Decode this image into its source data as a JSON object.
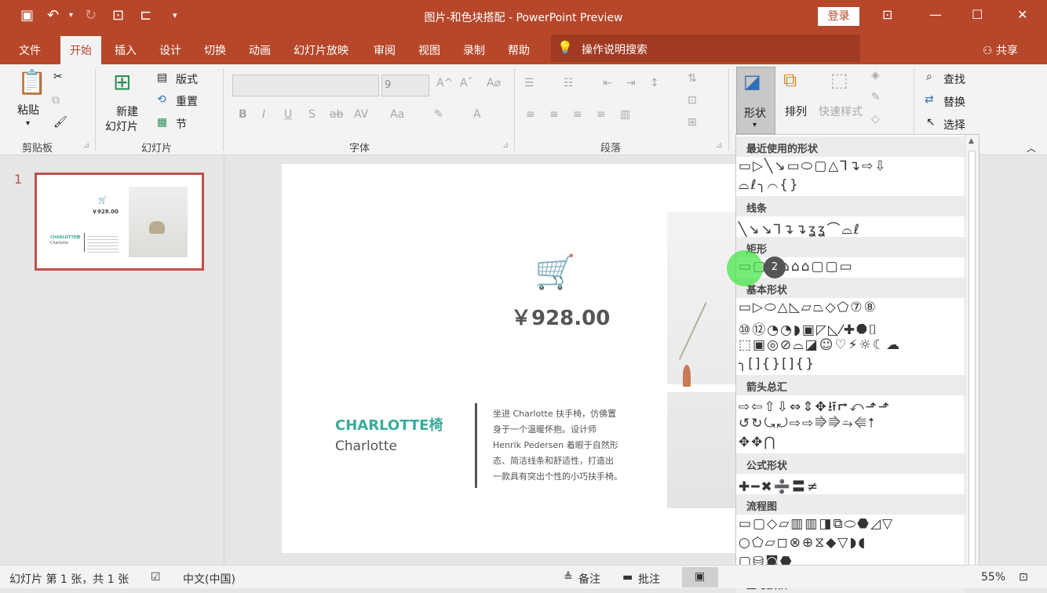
{
  "titlebar": {
    "title": "图片-和色块搭配  -  PowerPoint Preview",
    "login": "登录"
  },
  "tabs": [
    "文件",
    "开始",
    "插入",
    "设计",
    "切换",
    "动画",
    "幻灯片放映",
    "审阅",
    "视图",
    "录制",
    "帮助"
  ],
  "search": "操作说明搜索",
  "share": "共享",
  "ribbon": {
    "clipboard": {
      "paste": "粘贴",
      "label": "剪贴板"
    },
    "slides": {
      "new_line1": "新建",
      "new_line2": "幻灯片",
      "layout": "版式",
      "reset": "重置",
      "section": "节",
      "label": "幻灯片"
    },
    "font": {
      "size": "9",
      "label": "字体"
    },
    "paragraph": {
      "label": "段落"
    },
    "drawing": {
      "shapes": "形状",
      "arrange": "排列",
      "quick_styles": "快速样式"
    },
    "editing": {
      "find": "查找",
      "replace": "替换",
      "select": "选择"
    }
  },
  "slide_number": "1",
  "slide": {
    "price": "￥928.00",
    "name": "CHARLOTTE椅",
    "subtitle": "Charlotte",
    "desc_lines": [
      "坐进 Charlotte 扶手椅，仿佛置",
      "身于一个温暖怀抱。设计师",
      "Henrik Pedersen 着眼于自然形",
      "态、简洁线条和舒适性，打造出",
      "一款具有突出个性的小巧扶手椅。"
    ]
  },
  "thumb": {
    "price": "￥928.00",
    "name": "CHARLOTTE椅",
    "sub": "Charlotte"
  },
  "shapes_menu": {
    "sections": [
      "最近使用的形状",
      "线条",
      "矩形",
      "基本形状",
      "箭头总汇",
      "公式形状",
      "流程图",
      "星与旗帜"
    ],
    "rows": {
      "recent1": "▭▷╲↘▭⬭▢△⅂↴⇨⇩",
      "recent2": "⌓ℓ╮⌒{}",
      "lines": "╲↘↘⅂↴↴ʓʓ⌒⌓ℓ",
      "rect": "▭▢▢⌂⌂⌂▢▢▭",
      "basic1": "▭▷⬭△◺▱⏢◇⬠⑦⑧",
      "basic2": "⑩⑫◔◔◗▣◸◺⁄✚⯃⌷",
      "basic3": "⬚▣◎⊘⌓◪☺♡⚡☼☾☁",
      "basic4": "╮[]{}[]{}",
      "arrows1": "⇨⇦⇧⇩⇔⇕✥⭿⮣⤺⬏⬏",
      "arrows2": "↺↻⤿⤾⇨⇨⭆⭆⭇⭅⭡",
      "arrows3": "✥✥⋂",
      "math": "✚━✖➗〓≠",
      "flow1": "▭▢◇▱▥▥◨⧉⬭⬣◿▽",
      "flow2": "○⬠▱◻⊗⊕⧖◆▽◗◖",
      "flow3": "▢⛁◙⬣"
    }
  },
  "click_badge": "2",
  "status": {
    "slide_info": "幻灯片 第 1 张，共 1 张",
    "language": "中文(中国)",
    "notes": "备注",
    "comments": "批注",
    "zoom": "55%"
  },
  "colors": {
    "accent": "#b7472a",
    "teal": "#3cab9a"
  }
}
